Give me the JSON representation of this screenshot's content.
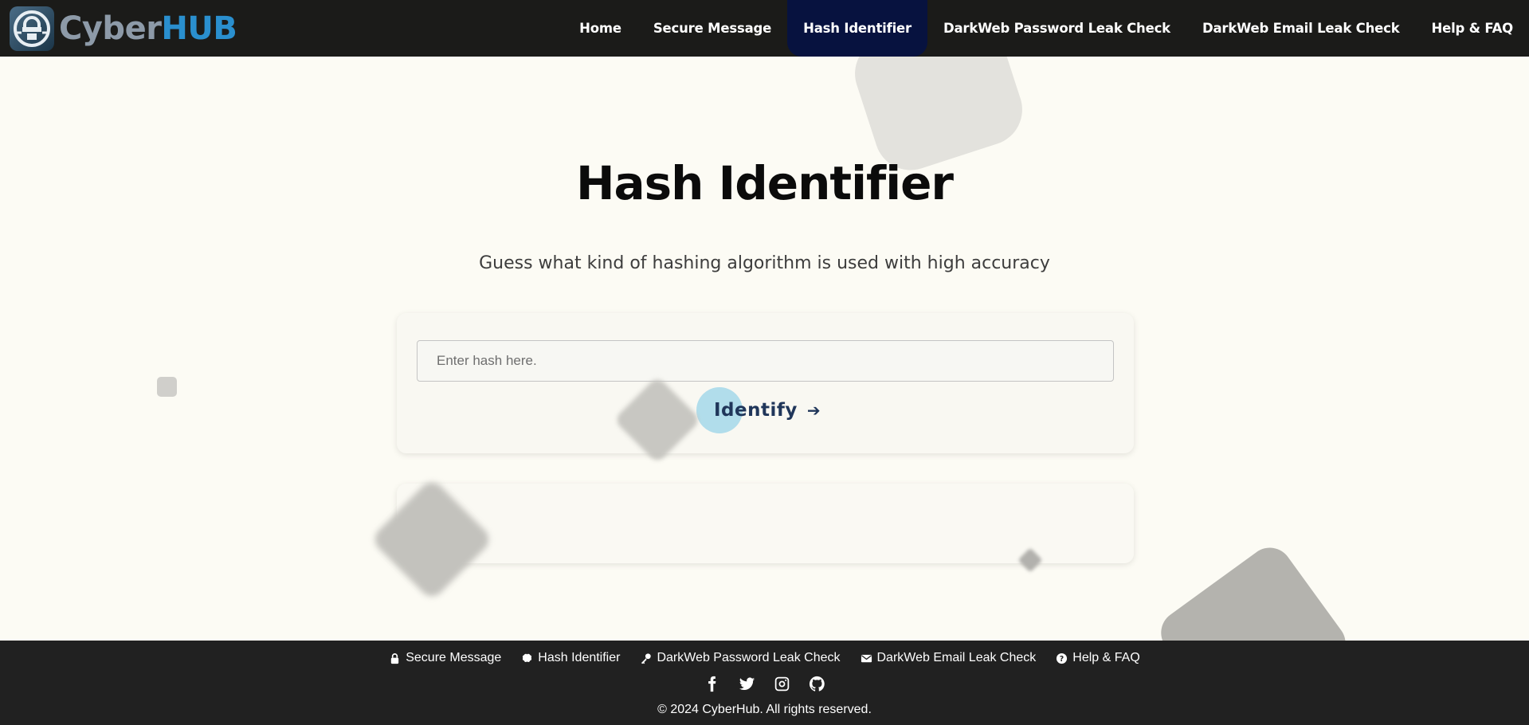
{
  "brand": {
    "name_part1": "Cyber",
    "name_part2": "HUB",
    "logo_icon": "lock-shield-icon"
  },
  "nav": {
    "items": [
      {
        "label": "Home"
      },
      {
        "label": "Secure Message"
      },
      {
        "label": "Hash Identifier",
        "active": true
      },
      {
        "label": "DarkWeb Password Leak Check"
      },
      {
        "label": "DarkWeb Email Leak Check"
      },
      {
        "label": "Help & FAQ"
      }
    ]
  },
  "main": {
    "title": "Hash Identifier",
    "subtitle": "Guess what kind of hashing algorithm is used with high accuracy",
    "input": {
      "placeholder": "Enter hash here.",
      "value": ""
    },
    "button": {
      "label": "Identify",
      "icon": "arrow-right-icon"
    },
    "result": {
      "text": ""
    }
  },
  "footer": {
    "links": [
      {
        "label": "Secure Message",
        "icon": "lock-icon"
      },
      {
        "label": "Hash Identifier",
        "icon": "brain-icon"
      },
      {
        "label": "DarkWeb Password Leak Check",
        "icon": "key-icon"
      },
      {
        "label": "DarkWeb Email Leak Check",
        "icon": "envelope-icon"
      },
      {
        "label": "Help & FAQ",
        "icon": "question-circle-icon"
      }
    ],
    "socials": [
      "facebook-icon",
      "twitter-icon",
      "instagram-icon",
      "github-icon"
    ],
    "copyright": "© 2024 CyberHub. All rights reserved."
  },
  "colors": {
    "header_bg": "#1b1b19",
    "nav_active_bg": "#07123f",
    "page_bg": "#fcfbf4",
    "footer_bg": "#212121",
    "brand_blue": "#2a8fce",
    "button_text": "#20365a"
  }
}
